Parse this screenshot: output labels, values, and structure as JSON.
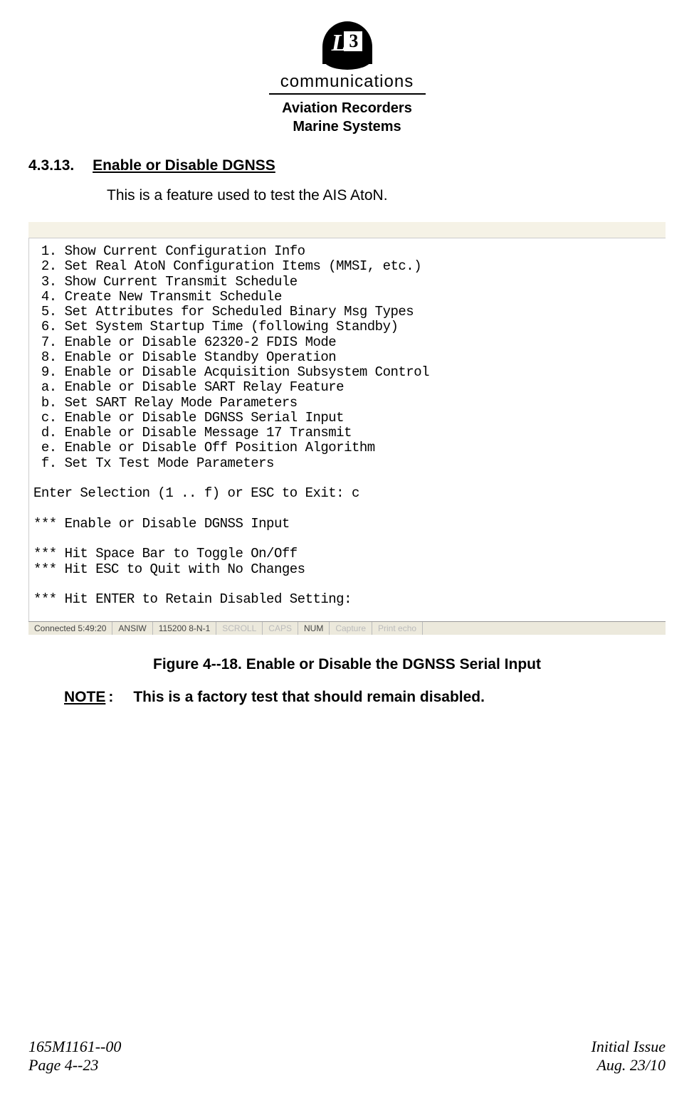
{
  "header": {
    "logo_l": "L",
    "logo_3": "3",
    "communications": "communications",
    "line1": "Aviation Recorders",
    "line2": "Marine Systems"
  },
  "section": {
    "number": "4.3.13.",
    "title": "Enable or Disable DGNSS",
    "body": "This is a feature used to test the AIS AtoN."
  },
  "terminal": {
    "menu": " 1. Show Current Configuration Info\n 2. Set Real AtoN Configuration Items (MMSI, etc.)\n 3. Show Current Transmit Schedule\n 4. Create New Transmit Schedule\n 5. Set Attributes for Scheduled Binary Msg Types\n 6. Set System Startup Time (following Standby)\n 7. Enable or Disable 62320-2 FDIS Mode\n 8. Enable or Disable Standby Operation\n 9. Enable or Disable Acquisition Subsystem Control\n a. Enable or Disable SART Relay Feature\n b. Set SART Relay Mode Parameters\n c. Enable or Disable DGNSS Serial Input\n d. Enable or Disable Message 17 Transmit\n e. Enable or Disable Off Position Algorithm\n f. Set Tx Test Mode Parameters",
    "prompt1": "Enter Selection (1 .. f) or ESC to Exit: c",
    "prompt2": "*** Enable or Disable DGNSS Input",
    "prompt3": "*** Hit Space Bar to Toggle On/Off\n*** Hit ESC to Quit with No Changes",
    "prompt4": "*** Hit ENTER to Retain Disabled Setting:"
  },
  "status": {
    "connected": "Connected 5:49:20",
    "term": "ANSIW",
    "baud": "115200 8-N-1",
    "scroll": "SCROLL",
    "caps": "CAPS",
    "num": "NUM",
    "capture": "Capture",
    "print": "Print echo"
  },
  "figure": {
    "caption": "Figure 4--18.  Enable or Disable the DGNSS Serial Input"
  },
  "note": {
    "label": "NOTE",
    "text": "This is a factory test that should remain disabled."
  },
  "footer": {
    "doc": "165M1161--00",
    "page": "Page 4--23",
    "issue": "Initial Issue",
    "date": "Aug. 23/10"
  }
}
